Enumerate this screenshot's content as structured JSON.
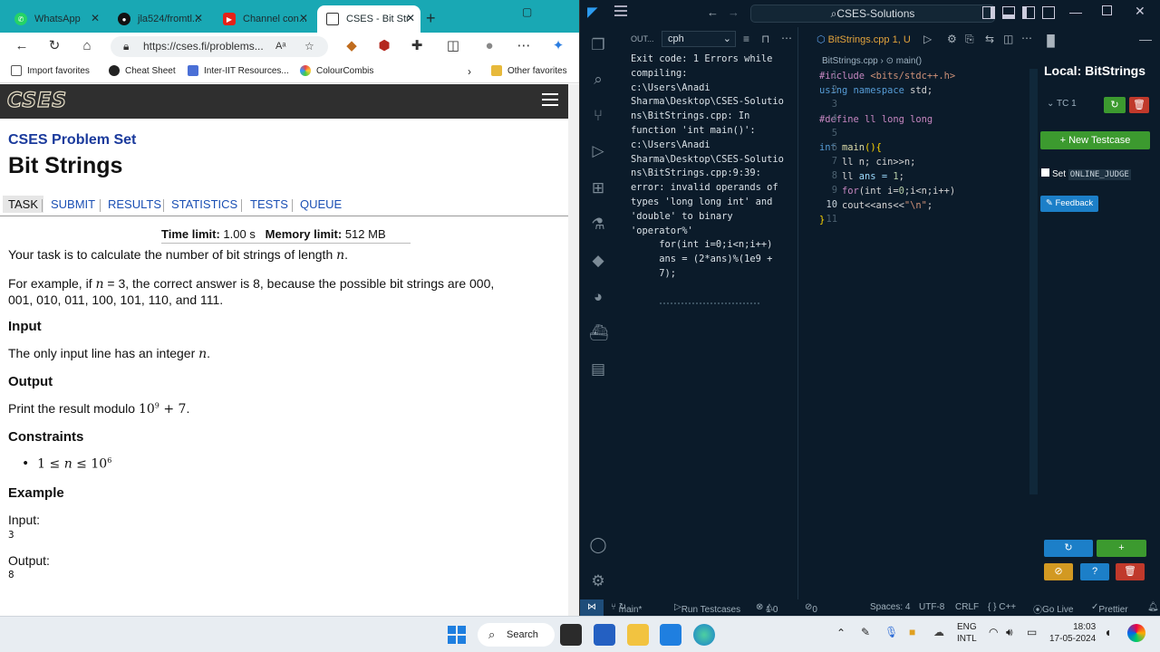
{
  "browser": {
    "tabs": [
      {
        "label": "WhatsApp"
      },
      {
        "label": "jla524/fromtl..."
      },
      {
        "label": "Channel con..."
      },
      {
        "label": "CSES - Bit Str"
      }
    ],
    "url": "https://cses.fi/problems...",
    "bookmarks": [
      "Import favorites",
      "Cheat Sheet",
      "Inter-IIT Resources...",
      "ColourCombis",
      "Other favorites"
    ]
  },
  "cses": {
    "logo": "CSES",
    "set_title": "CSES Problem Set",
    "title": "Bit Strings",
    "tabs": [
      "TASK",
      "SUBMIT",
      "RESULTS",
      "STATISTICS",
      "TESTS",
      "QUEUE"
    ],
    "time_label": "Time limit:",
    "time_value": "1.00 s",
    "mem_label": "Memory limit:",
    "mem_value": "512 MB",
    "intro": "Your task is to calculate the number of bit strings of length ",
    "example_a": "For example, if ",
    "example_b": ", the correct answer is ",
    "example_c": ", because the possible bit strings are 000,",
    "example_d": "001, 010, 011, 100, 101, 110, and 111.",
    "input_h": "Input",
    "input_t": "The only input line has an integer ",
    "output_h": "Output",
    "output_t": "Print the result modulo ",
    "constraints_h": "Constraints",
    "example_h": "Example",
    "ex_input_label": "Input:",
    "ex_input_value": "3",
    "ex_output_label": "Output:",
    "ex_output_value": "8"
  },
  "vscode": {
    "command_center": "CSES-Solutions",
    "panel_label": "OUT...",
    "panel_select": "cph",
    "editor_tab": "BitStrings.cpp 1, U",
    "breadcrumb_file": "BitStrings.cpp",
    "breadcrumb_fn": "main()",
    "output_text": "Exit code: 1 Errors while\ncompiling:\nc:\\Users\\Anadi\nSharma\\Desktop\\CSES-Solutio\nns\\BitStrings.cpp: In\nfunction 'int main()':\nc:\\Users\\Anadi\nSharma\\Desktop\\CSES-Solutio\nns\\BitStrings.cpp:9:39:\nerror: invalid operands of\ntypes 'long long int' and\n'double' to binary\n'operator%'\n     for(int i=0;i<n;i++)\n     ans = (2*ans)%(1e9 +\n     7);",
    "code_lines": [
      [
        {
          "t": "#include ",
          "c": "#c586c0"
        },
        {
          "t": "<bits/stdc++.h>",
          "c": "#ce9178"
        }
      ],
      [
        {
          "t": "using namespace ",
          "c": "#569cd6"
        },
        {
          "t": "std;",
          "c": "#d4d4d4"
        }
      ],
      [],
      [
        {
          "t": "#define ll long long",
          "c": "#c586c0"
        }
      ],
      [],
      [
        {
          "t": "int ",
          "c": "#569cd6"
        },
        {
          "t": "main",
          "c": "#dcdcaa"
        },
        {
          "t": "(){",
          "c": "#ffd700"
        }
      ],
      [
        {
          "t": "    ll n; cin>>n;",
          "c": "#d4d4d4"
        }
      ],
      [
        {
          "t": "    ll ",
          "c": "#d4d4d4"
        },
        {
          "t": "ans = ",
          "c": "#9cdcfe"
        },
        {
          "t": "1",
          "c": "#b5cea8"
        },
        {
          "t": ";",
          "c": "#d4d4d4"
        }
      ],
      [
        {
          "t": "    for",
          "c": "#c586c0"
        },
        {
          "t": "(int i=",
          "c": "#d4d4d4"
        },
        {
          "t": "0",
          "c": "#b5cea8"
        },
        {
          "t": ";i<n;i++)",
          "c": "#d4d4d4"
        }
      ],
      [
        {
          "t": "    cout<<ans<<",
          "c": "#d4d4d4"
        },
        {
          "t": "\"\\n\"",
          "c": "#ce9178"
        },
        {
          "t": ";",
          "c": "#d4d4d4"
        }
      ],
      [
        {
          "t": "}",
          "c": "#ffd700"
        }
      ]
    ],
    "line_numbers": [
      "1",
      "2",
      "3",
      "4",
      "5",
      "6",
      "7",
      "8",
      "9",
      "10",
      "11"
    ],
    "cph": {
      "title": "Local: BitStrings",
      "tc": "TC 1",
      "new_testcase": "+ New Testcase",
      "set_label": "Set",
      "online_judge": "ONLINE_JUDGE",
      "feedback": "Feedback"
    },
    "status": {
      "branch": "main*",
      "run": "Run Testcases",
      "errors": "1",
      "warnings": "0",
      "ports": "0",
      "spaces": "Spaces: 4",
      "encoding": "UTF-8",
      "eol": "CRLF",
      "lang": "{ } C++",
      "golive": "Go Live",
      "prettier": "Prettier"
    }
  },
  "taskbar": {
    "search": "Search",
    "lang1": "ENG",
    "lang2": "INTL",
    "time": "18:03",
    "date": "17-05-2024"
  },
  "colors": {
    "browser_tabbar": "#19a8b4",
    "cses_bar": "#2f2f2f",
    "link": "#1a4fb4",
    "vscode_bg": "#0b1b2a",
    "cph_green": "#3c9a2f",
    "cph_blue": "#1c7fc8",
    "cph_orange": "#d29922",
    "cph_red": "#c0392b"
  },
  "icons": [
    "whatsapp-icon",
    "github-icon",
    "youtube-icon",
    "back-icon",
    "refresh-icon",
    "home-icon",
    "star-icon",
    "extension-icon",
    "profile-icon",
    "menu-icon",
    "vscode-icon",
    "explorer-icon",
    "search-icon",
    "source-control-icon",
    "run-debug-icon",
    "extensions-icon",
    "account-icon",
    "settings-icon",
    "windows-start-icon",
    "wifi-icon",
    "volume-icon",
    "battery-icon"
  ]
}
